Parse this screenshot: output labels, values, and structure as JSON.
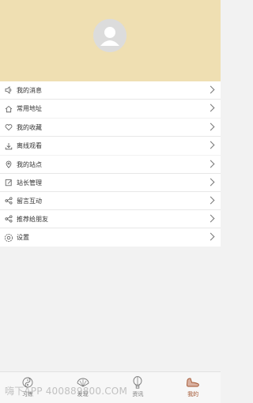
{
  "header": {
    "bg_color": "#efdfb2"
  },
  "menu": {
    "group1": [
      {
        "label": "我的消息",
        "icon": "speaker-icon"
      },
      {
        "label": "常用地址",
        "icon": "home-icon"
      }
    ],
    "group2": [
      {
        "label": "我的收藏",
        "icon": "heart-icon"
      },
      {
        "label": "离线观看",
        "icon": "download-icon"
      }
    ],
    "group3": [
      {
        "label": "我的站点",
        "icon": "location-pin-icon"
      },
      {
        "label": "站长管理",
        "icon": "edit-icon"
      },
      {
        "label": "留言互动",
        "icon": "share-icon"
      },
      {
        "label": "推荐给朋友",
        "icon": "share-icon"
      },
      {
        "label": "设置",
        "icon": "gear-icon"
      }
    ]
  },
  "tabbar": {
    "tabs": [
      {
        "label": "习练",
        "icon": "yin-yang-icon",
        "active": false
      },
      {
        "label": "发现",
        "icon": "fan-icon",
        "active": false
      },
      {
        "label": "资讯",
        "icon": "hot-air-balloon-icon",
        "active": false
      },
      {
        "label": "我的",
        "icon": "shoe-icon",
        "active": true
      }
    ],
    "active_color": "#a0522d"
  },
  "watermark": "嗨下APP 400889800.COM"
}
